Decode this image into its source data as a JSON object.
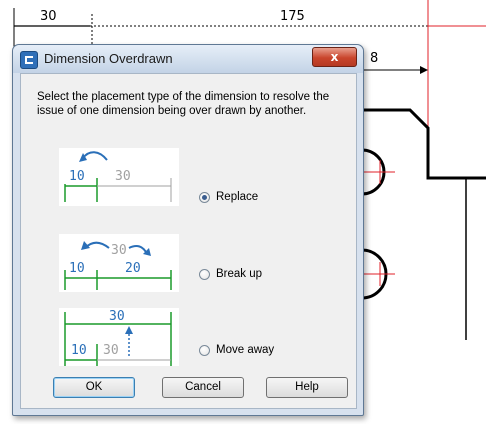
{
  "cad": {
    "dim_left": "30",
    "dim_top": "175",
    "dim_right": "8"
  },
  "dialog": {
    "title": "Dimension Overdrawn",
    "close_label": "x",
    "description": "Select the placement type of the dimension to resolve the issue of one dimension being over drawn by another.",
    "options": [
      {
        "label": "Replace",
        "selected": true,
        "dims": [
          "10",
          "30"
        ]
      },
      {
        "label": "Break up",
        "selected": false,
        "dims": [
          "10",
          "30",
          "20"
        ]
      },
      {
        "label": "Move away",
        "selected": false,
        "dims": [
          "30",
          "10",
          "30"
        ]
      }
    ],
    "buttons": {
      "ok": "OK",
      "cancel": "Cancel",
      "help": "Help"
    }
  },
  "colors": {
    "dim_green": "#1a9a2a",
    "dim_blue": "#2a6fb8",
    "dim_grey": "#a0a0a0",
    "cad_red": "#e0202a"
  }
}
